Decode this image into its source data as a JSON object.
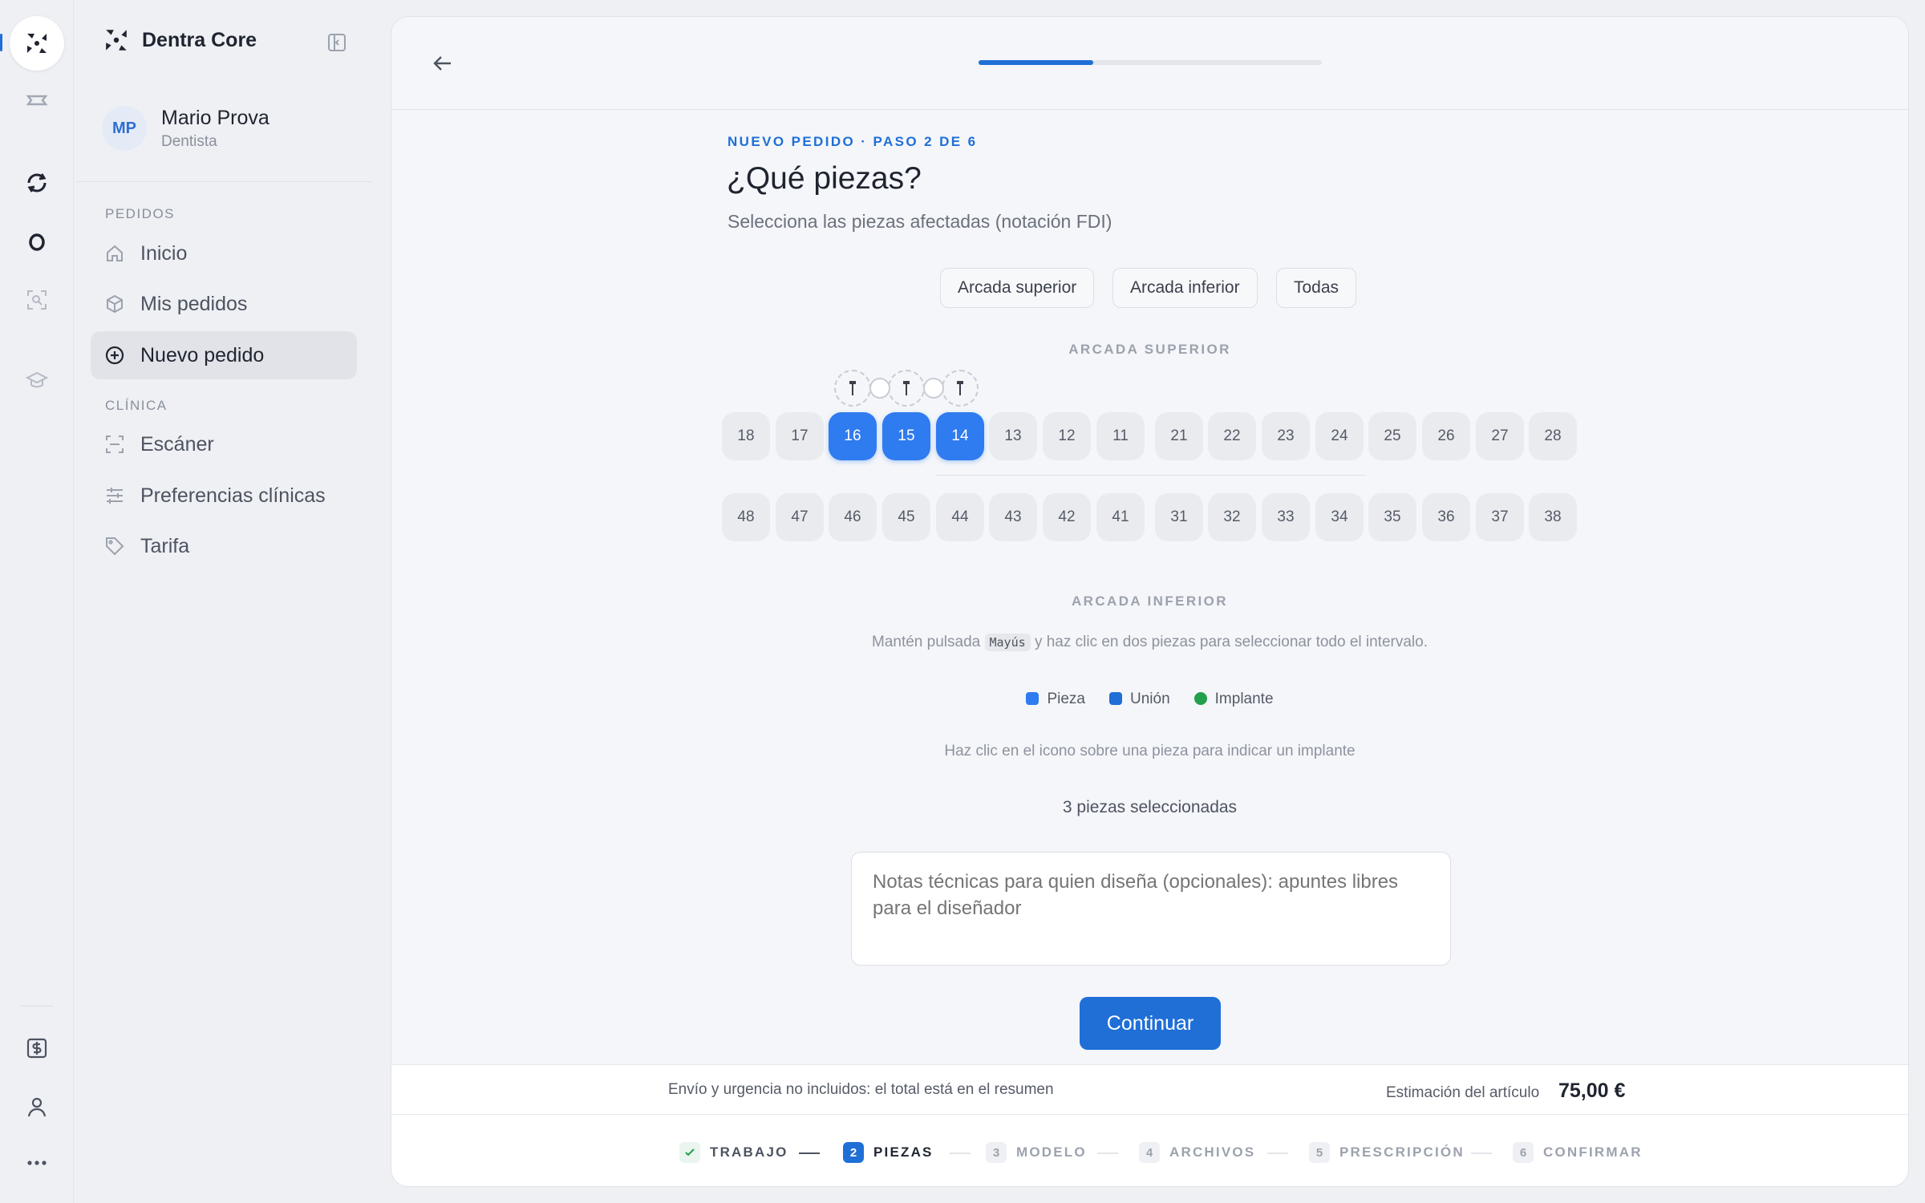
{
  "app": {
    "name": "Dentra Core"
  },
  "user": {
    "initials": "MP",
    "name": "Mario Prova",
    "role": "Dentista"
  },
  "sidebar": {
    "sections": [
      {
        "label": "PEDIDOS",
        "items": [
          {
            "label": "Inicio",
            "icon": "home-icon"
          },
          {
            "label": "Mis pedidos",
            "icon": "box-icon"
          },
          {
            "label": "Nuevo pedido",
            "icon": "plus-circle-icon",
            "active": true
          }
        ]
      },
      {
        "label": "CLÍNICA",
        "items": [
          {
            "label": "Escáner",
            "icon": "scan-icon"
          },
          {
            "label": "Preferencias clínicas",
            "icon": "sliders-icon"
          },
          {
            "label": "Tarifa",
            "icon": "tag-icon"
          }
        ]
      }
    ]
  },
  "header": {
    "progress_fraction": 0.333
  },
  "wizard": {
    "eyebrow": "NUEVO PEDIDO · PASO 2 DE 6",
    "title": "¿Qué piezas?",
    "subtitle": "Selecciona las piezas afectadas (notación FDI)",
    "quick_select": [
      "Arcada superior",
      "Arcada inferior",
      "Todas"
    ],
    "upper_label": "ARCADA SUPERIOR",
    "lower_label": "ARCADA INFERIOR",
    "upper_teeth": [
      "18",
      "17",
      "16",
      "15",
      "14",
      "13",
      "12",
      "11",
      "21",
      "22",
      "23",
      "24",
      "25",
      "26",
      "27",
      "28"
    ],
    "lower_teeth": [
      "48",
      "47",
      "46",
      "45",
      "44",
      "43",
      "42",
      "41",
      "31",
      "32",
      "33",
      "34",
      "35",
      "36",
      "37",
      "38"
    ],
    "selected": [
      "16",
      "15",
      "14"
    ],
    "hint_prefix": "Mantén pulsada",
    "hint_key": "Mayús",
    "hint_suffix": "y haz clic en dos piezas para seleccionar todo el intervalo.",
    "legend": [
      {
        "label": "Pieza",
        "color": "#2f7bf0"
      },
      {
        "label": "Unión",
        "color": "#1f6fd6"
      },
      {
        "label": "Implante",
        "color": "#22a04b"
      }
    ],
    "implant_hint": "Haz clic en el icono sobre una pieza para indicar un implante",
    "selection_count": "3 piezas seleccionadas",
    "notes_placeholder": "Notas técnicas para quien diseña (opcionales): apuntes libres para el diseñador",
    "continue_label": "Continuar"
  },
  "estimate": {
    "shipping_note": "Envío y urgencia no incluidos: el total está en el resumen",
    "label": "Estimación del artículo",
    "value": "75,00 €"
  },
  "steps": [
    {
      "num": "✓",
      "label": "TRABAJO",
      "state": "done"
    },
    {
      "num": "2",
      "label": "PIEZAS",
      "state": "current"
    },
    {
      "num": "3",
      "label": "MODELO",
      "state": "todo"
    },
    {
      "num": "4",
      "label": "ARCHIVOS",
      "state": "todo"
    },
    {
      "num": "5",
      "label": "PRESCRIPCIÓN",
      "state": "todo"
    },
    {
      "num": "6",
      "label": "CONFIRMAR",
      "state": "todo"
    }
  ],
  "colors": {
    "accent": "#1f6fd6",
    "selected_tooth": "#2f7bf0"
  }
}
